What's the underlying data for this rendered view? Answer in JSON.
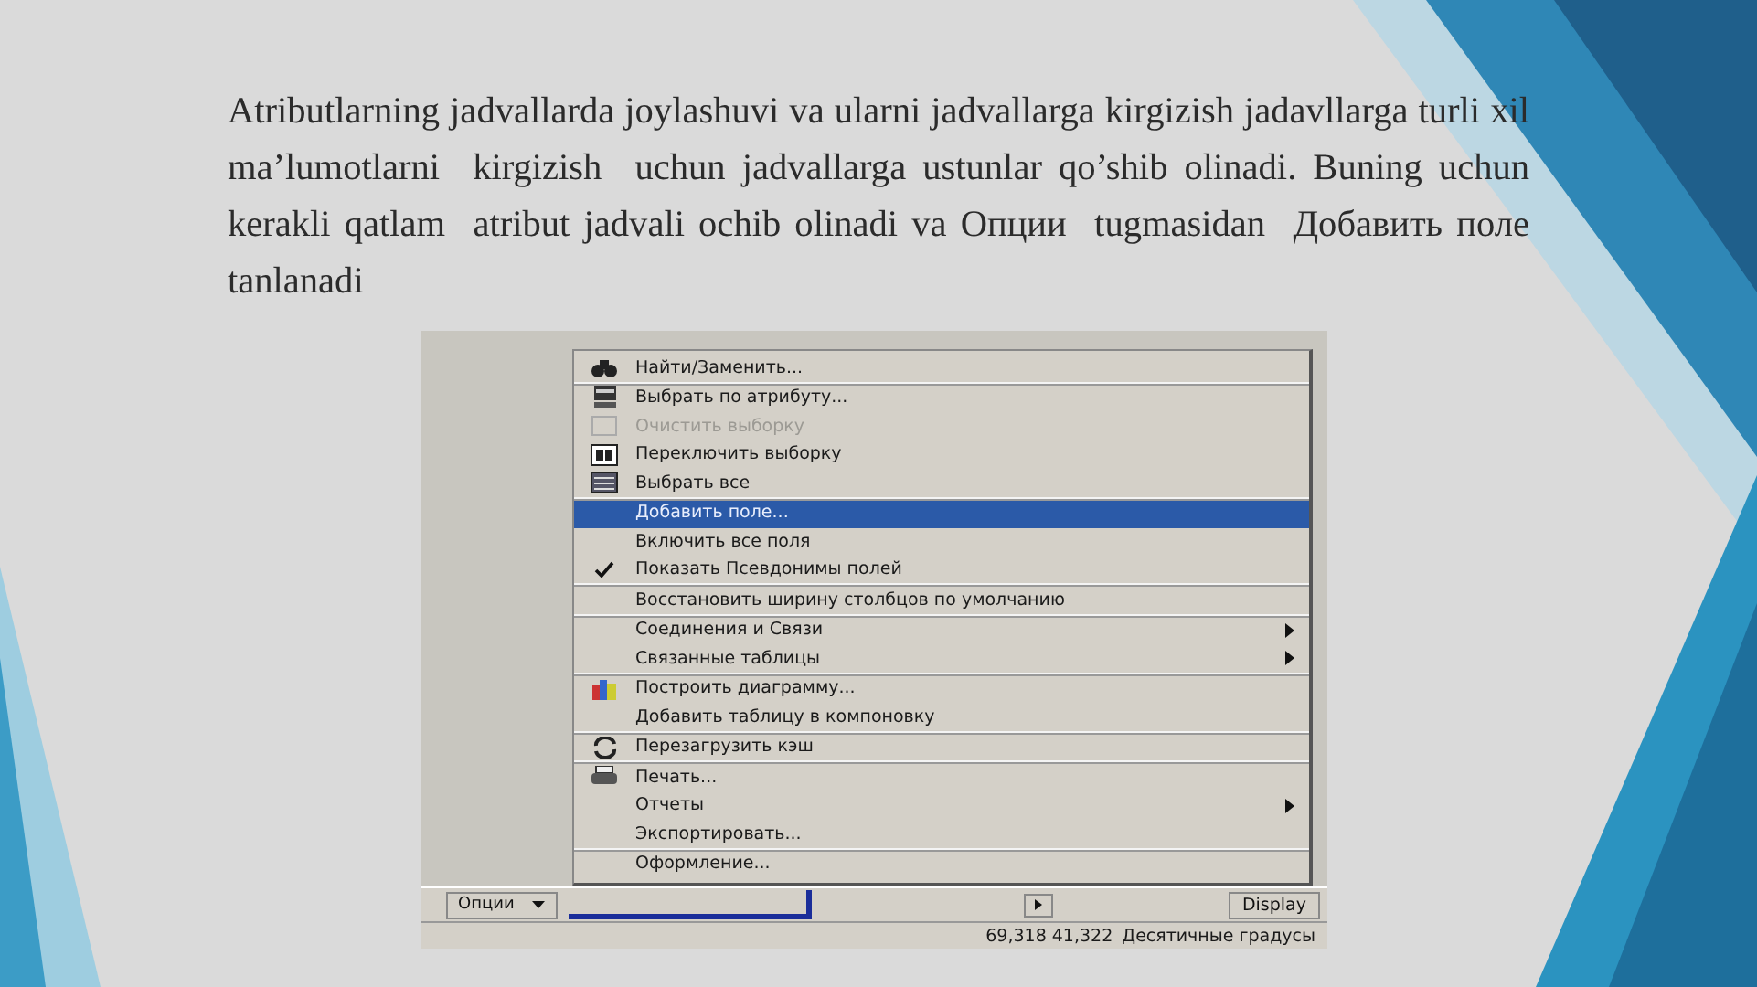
{
  "paragraph": "Atributlarning jadvallarda joylashuvi va ularni jadvallarga kirgizish jadavllarga turli xil ma’lumotlarni  kirgizish  uchun jadvallarga ustunlar qo’shib olinadi. Buning uchun kerakli qatlam  atribut jadvali ochib olinadi va Опции  tugmasidan  Добавить поле tanlanadi",
  "screenshot": {
    "menu": [
      {
        "label": "Найти/Заменить...",
        "kind": "binoculars",
        "disabled": false,
        "selected": false,
        "checked": false,
        "submenu": false,
        "separator_after": true
      },
      {
        "label": "Выбрать по атрибуту...",
        "kind": "sql",
        "disabled": false,
        "selected": false,
        "checked": false,
        "submenu": false,
        "separator_after": false
      },
      {
        "label": "Очистить выборку",
        "kind": "clear",
        "disabled": true,
        "selected": false,
        "checked": false,
        "submenu": false,
        "separator_after": false
      },
      {
        "label": "Переключить выборку",
        "kind": "switch",
        "disabled": false,
        "selected": false,
        "checked": false,
        "submenu": false,
        "separator_after": false
      },
      {
        "label": "Выбрать все",
        "kind": "list",
        "disabled": false,
        "selected": false,
        "checked": false,
        "submenu": false,
        "separator_after": true
      },
      {
        "label": "Добавить поле...",
        "kind": "plain",
        "disabled": false,
        "selected": true,
        "checked": false,
        "submenu": false,
        "separator_after": false
      },
      {
        "label": "Включить все поля",
        "kind": "plain",
        "disabled": false,
        "selected": false,
        "checked": false,
        "submenu": false,
        "separator_after": false
      },
      {
        "label": "Показать Псевдонимы полей",
        "kind": "plain",
        "disabled": false,
        "selected": false,
        "checked": true,
        "submenu": false,
        "separator_after": true
      },
      {
        "label": "Восстановить ширину столбцов по умолчанию",
        "kind": "plain",
        "disabled": false,
        "selected": false,
        "checked": false,
        "submenu": false,
        "separator_after": true
      },
      {
        "label": "Соединения и Связи",
        "kind": "plain",
        "disabled": false,
        "selected": false,
        "checked": false,
        "submenu": true,
        "separator_after": false
      },
      {
        "label": "Связанные таблицы",
        "kind": "plain",
        "disabled": false,
        "selected": false,
        "checked": false,
        "submenu": true,
        "separator_after": true
      },
      {
        "label": "Построить диаграмму...",
        "kind": "chart",
        "disabled": false,
        "selected": false,
        "checked": false,
        "submenu": false,
        "separator_after": false
      },
      {
        "label": "Добавить таблицу в компоновку",
        "kind": "plain",
        "disabled": false,
        "selected": false,
        "checked": false,
        "submenu": false,
        "separator_after": true
      },
      {
        "label": "Перезагрузить кэш",
        "kind": "refresh",
        "disabled": false,
        "selected": false,
        "checked": false,
        "submenu": false,
        "separator_after": true
      },
      {
        "label": "Печать...",
        "kind": "printer",
        "disabled": false,
        "selected": false,
        "checked": false,
        "submenu": false,
        "separator_after": false
      },
      {
        "label": "Отчеты",
        "kind": "plain",
        "disabled": false,
        "selected": false,
        "checked": false,
        "submenu": true,
        "separator_after": false
      },
      {
        "label": "Экспортировать...",
        "kind": "plain",
        "disabled": false,
        "selected": false,
        "checked": false,
        "submenu": false,
        "separator_after": true
      },
      {
        "label": "Оформление...",
        "kind": "plain",
        "disabled": false,
        "selected": false,
        "checked": false,
        "submenu": false,
        "separator_after": false
      }
    ],
    "options_button": "Опции",
    "display_button": "Display",
    "status": {
      "coordinates": "69,318  41,322",
      "units": "Десятичные градусы"
    }
  }
}
